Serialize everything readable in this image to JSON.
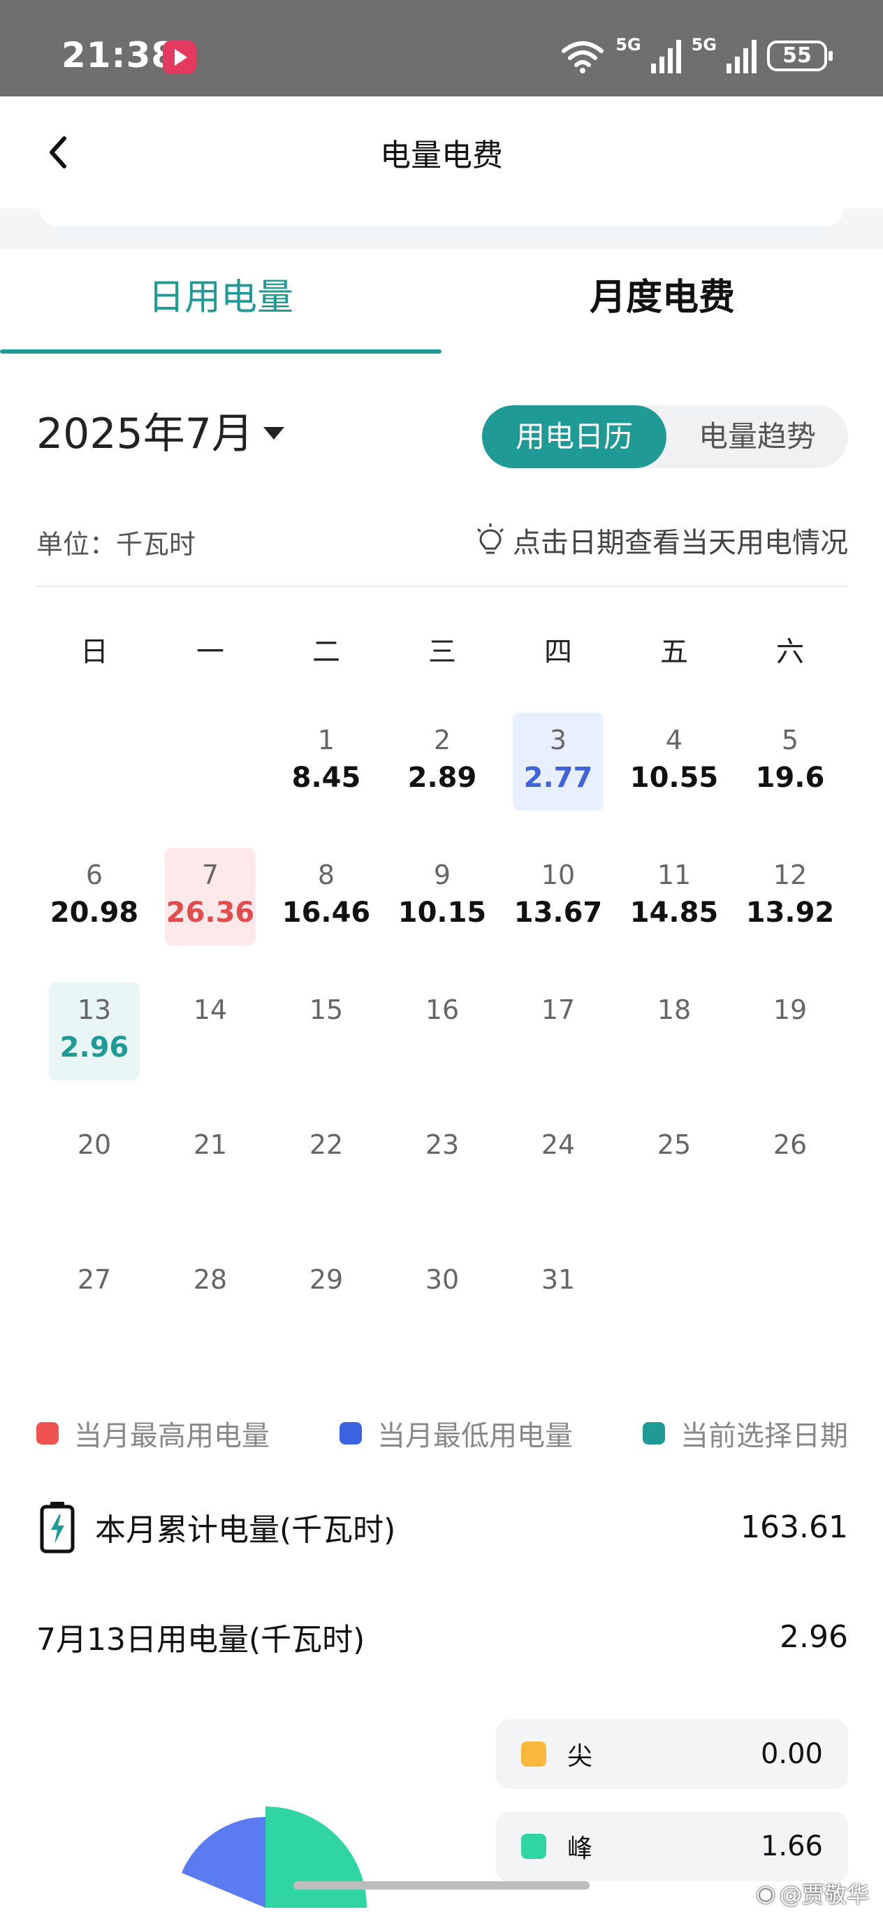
{
  "status_bar": {
    "time": "21:38",
    "network_1": "5G",
    "network_2": "5G",
    "battery": "55"
  },
  "header": {
    "title": "电量电费"
  },
  "tabs": [
    {
      "label": "日用电量",
      "active": true
    },
    {
      "label": "月度电费",
      "active": false
    }
  ],
  "month_picker": {
    "label": "2025年7月"
  },
  "view_toggle": {
    "calendar": "用电日历",
    "trend": "电量趋势"
  },
  "unit_label": "单位：千瓦时",
  "tip": "点击日期查看当天用电情况",
  "weekdays": [
    "日",
    "一",
    "二",
    "三",
    "四",
    "五",
    "六"
  ],
  "calendar": [
    [
      null,
      null,
      {
        "day": "1",
        "value": "8.45"
      },
      {
        "day": "2",
        "value": "2.89"
      },
      {
        "day": "3",
        "value": "2.77",
        "state": "low"
      },
      {
        "day": "4",
        "value": "10.55"
      },
      {
        "day": "5",
        "value": "19.6"
      }
    ],
    [
      {
        "day": "6",
        "value": "20.98"
      },
      {
        "day": "7",
        "value": "26.36",
        "state": "high"
      },
      {
        "day": "8",
        "value": "16.46"
      },
      {
        "day": "9",
        "value": "10.15"
      },
      {
        "day": "10",
        "value": "13.67"
      },
      {
        "day": "11",
        "value": "14.85"
      },
      {
        "day": "12",
        "value": "13.92"
      }
    ],
    [
      {
        "day": "13",
        "value": "2.96",
        "state": "sel"
      },
      {
        "day": "14"
      },
      {
        "day": "15"
      },
      {
        "day": "16"
      },
      {
        "day": "17"
      },
      {
        "day": "18"
      },
      {
        "day": "19"
      }
    ],
    [
      {
        "day": "20"
      },
      {
        "day": "21"
      },
      {
        "day": "22"
      },
      {
        "day": "23"
      },
      {
        "day": "24"
      },
      {
        "day": "25"
      },
      {
        "day": "26"
      }
    ],
    [
      {
        "day": "27"
      },
      {
        "day": "28"
      },
      {
        "day": "29"
      },
      {
        "day": "30"
      },
      {
        "day": "31"
      },
      null,
      null
    ]
  ],
  "legend": [
    {
      "label": "当月最高用电量",
      "color": "#ef5350"
    },
    {
      "label": "当月最低用电量",
      "color": "#3b63e0"
    },
    {
      "label": "当前选择日期",
      "color": "#1f9a94"
    }
  ],
  "month_total": {
    "label": "本月累计电量(千瓦时)",
    "value": "163.61"
  },
  "day_total": {
    "label": "7月13日用电量(千瓦时)",
    "value": "2.96"
  },
  "breakdown": [
    {
      "name": "尖",
      "value": "0.00",
      "color": "#f9b93d"
    },
    {
      "name": "峰",
      "value": "1.66",
      "color": "#2fd6a3"
    }
  ],
  "pie_colors": {
    "blue": "#5b7cf0",
    "green": "#2fd6a3"
  },
  "watermark": "@贾敬华"
}
